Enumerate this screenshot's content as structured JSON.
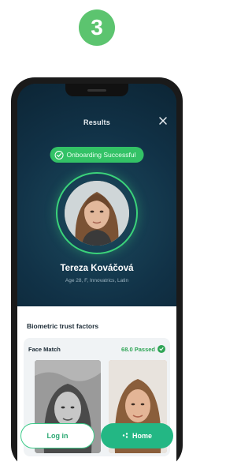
{
  "step": {
    "number": "3"
  },
  "screen": {
    "title": "Results",
    "status_pill": "Onboarding Successful",
    "person": {
      "name": "Tereza Kováčová",
      "details": "Age 28, F, Innovatrics, Latin"
    },
    "section_title": "Biometric trust factors",
    "card": {
      "label": "Face Match",
      "status": "68.0 Passed"
    },
    "buttons": {
      "login": "Log in",
      "home": "Home"
    }
  },
  "colors": {
    "accent_green": "#5cc46f",
    "pill_green": "#33c266",
    "header_bg": "#0f2f45",
    "home_button": "#23b784"
  },
  "icons": {
    "close": "close-icon",
    "check": "check-circle-icon",
    "home": "home-icon"
  }
}
